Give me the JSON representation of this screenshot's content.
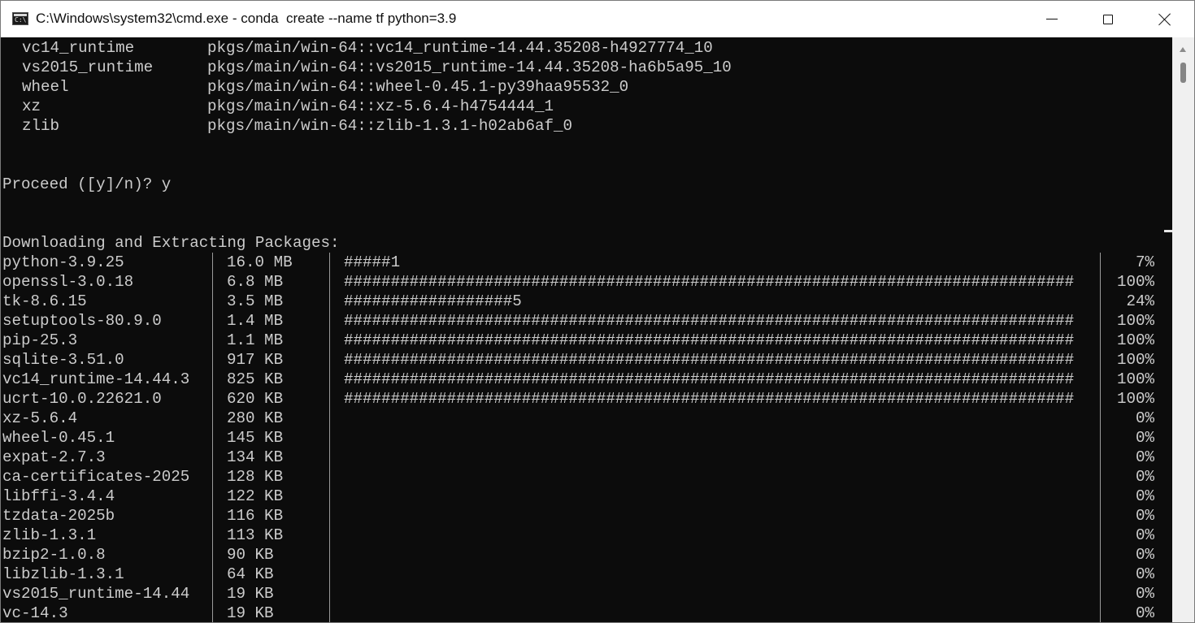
{
  "window": {
    "title": "C:\\Windows\\system32\\cmd.exe - conda  create --name tf python=3.9",
    "app_icon": "cmd-icon",
    "app_icon_text": "C:\\",
    "controls": {
      "minimize": "minimize-icon",
      "maximize": "maximize-icon",
      "close": "close-icon"
    }
  },
  "colors": {
    "console_bg": "#0c0c0c",
    "console_fg": "#cccccc",
    "titlebar_bg": "#ffffff"
  },
  "package_list": [
    {
      "name": "vc14_runtime",
      "spec": "pkgs/main/win-64::vc14_runtime-14.44.35208-h4927774_10"
    },
    {
      "name": "vs2015_runtime",
      "spec": "pkgs/main/win-64::vs2015_runtime-14.44.35208-ha6b5a95_10"
    },
    {
      "name": "wheel",
      "spec": "pkgs/main/win-64::wheel-0.45.1-py39haa95532_0"
    },
    {
      "name": "xz",
      "spec": "pkgs/main/win-64::xz-5.6.4-h4754444_1"
    },
    {
      "name": "zlib",
      "spec": "pkgs/main/win-64::zlib-1.3.1-h02ab6af_0"
    }
  ],
  "prompt": "Proceed ([y]/n)? y",
  "downloading_header": "Downloading and Extracting Packages:",
  "downloads": [
    {
      "name": "python-3.9.25",
      "size": "16.0 MB",
      "bar": "#####1",
      "percent": "7%"
    },
    {
      "name": "openssl-3.0.18",
      "size": "6.8 MB",
      "bar": "##############################################################################",
      "percent": "100%"
    },
    {
      "name": "tk-8.6.15",
      "size": "3.5 MB",
      "bar": "##################5",
      "percent": "24%"
    },
    {
      "name": "setuptools-80.9.0",
      "size": "1.4 MB",
      "bar": "##############################################################################",
      "percent": "100%"
    },
    {
      "name": "pip-25.3",
      "size": "1.1 MB",
      "bar": "##############################################################################",
      "percent": "100%"
    },
    {
      "name": "sqlite-3.51.0",
      "size": "917 KB",
      "bar": "##############################################################################",
      "percent": "100%"
    },
    {
      "name": "vc14_runtime-14.44.3",
      "size": "825 KB",
      "bar": "##############################################################################",
      "percent": "100%"
    },
    {
      "name": "ucrt-10.0.22621.0",
      "size": "620 KB",
      "bar": "##############################################################################",
      "percent": "100%"
    },
    {
      "name": "xz-5.6.4",
      "size": "280 KB",
      "bar": "",
      "percent": "0%"
    },
    {
      "name": "wheel-0.45.1",
      "size": "145 KB",
      "bar": "",
      "percent": "0%"
    },
    {
      "name": "expat-2.7.3",
      "size": "134 KB",
      "bar": "",
      "percent": "0%"
    },
    {
      "name": "ca-certificates-2025",
      "size": "128 KB",
      "bar": "",
      "percent": "0%"
    },
    {
      "name": "libffi-3.4.4",
      "size": "122 KB",
      "bar": "",
      "percent": "0%"
    },
    {
      "name": "tzdata-2025b",
      "size": "116 KB",
      "bar": "",
      "percent": "0%"
    },
    {
      "name": "zlib-1.3.1",
      "size": "113 KB",
      "bar": "",
      "percent": "0%"
    },
    {
      "name": "bzip2-1.0.8",
      "size": "90 KB",
      "bar": "",
      "percent": "0%"
    },
    {
      "name": "libzlib-1.3.1",
      "size": "64 KB",
      "bar": "",
      "percent": "0%"
    },
    {
      "name": "vs2015_runtime-14.44",
      "size": "19 KB",
      "bar": "",
      "percent": "0%"
    },
    {
      "name": "vc-14.3",
      "size": "19 KB",
      "bar": "",
      "percent": "0%"
    }
  ]
}
